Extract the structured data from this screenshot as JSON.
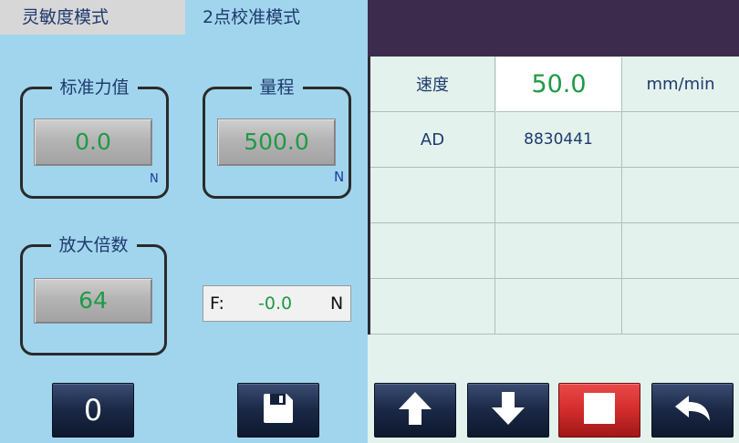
{
  "tabs": [
    {
      "label": "灵敏度模式",
      "active": false
    },
    {
      "label": "2点校准模式",
      "active": true
    }
  ],
  "standard_force": {
    "title": "标准力值",
    "value": "0.0",
    "unit": "N"
  },
  "range": {
    "title": "量程",
    "value": "500.0",
    "unit": "N"
  },
  "gain": {
    "title": "放大倍数",
    "value": "64"
  },
  "force_readout": {
    "label": "F:",
    "value": "-0.0",
    "unit": "N"
  },
  "table": {
    "rows": [
      [
        "速度",
        "50.0",
        "mm/min"
      ],
      [
        "AD",
        "8830441",
        ""
      ],
      [
        "",
        "",
        ""
      ],
      [
        "",
        "",
        ""
      ],
      [
        "",
        "",
        ""
      ]
    ]
  },
  "toolbar": {
    "zero_label": "0",
    "save_icon": "save-icon",
    "up_icon": "arrow-up-icon",
    "down_icon": "arrow-down-icon",
    "stop_icon": "stop-icon",
    "back_icon": "back-icon"
  },
  "colors": {
    "left_panel": "#a1d5ed",
    "header_bar": "#3d2b4d",
    "table_bg": "#e3f2ec",
    "value_green": "#1f9a45",
    "label_navy": "#1e3a6e",
    "stop_red": "#d42d2d",
    "button_navy": "#1b2947"
  }
}
